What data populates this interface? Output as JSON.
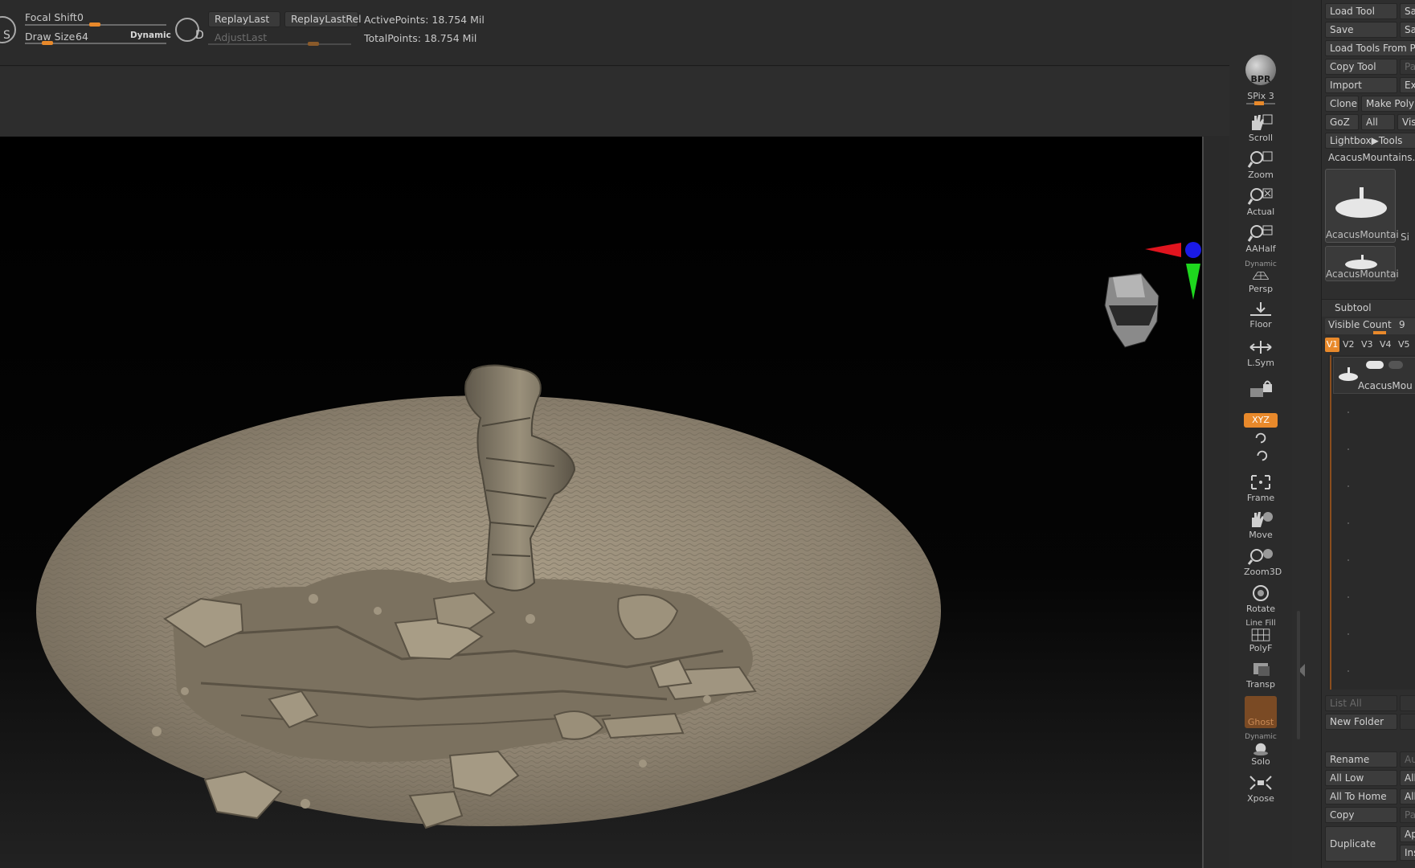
{
  "topbar": {
    "focal_shift_label": "Focal Shift",
    "focal_shift_value": "0",
    "draw_size_label": "Draw Size",
    "draw_size_value": "64",
    "dynamic_label": "Dynamic",
    "s_label": "S",
    "d_label": "D",
    "replay_last": "ReplayLast",
    "replay_last_rel": "ReplayLastRel",
    "adjust_last": "AdjustLast",
    "active_points": "ActivePoints: 18.754 Mil",
    "total_points": "TotalPoints: 18.754 Mil"
  },
  "shelf": {
    "bpr": "BPR",
    "spix_label": "SPix",
    "spix_value": "3",
    "scroll": "Scroll",
    "zoom": "Zoom",
    "actual": "Actual",
    "aahalf": "AAHalf",
    "dynamic_small": "Dynamic",
    "persp": "Persp",
    "floor": "Floor",
    "lsym": "L.Sym",
    "xyz": "XYZ",
    "frame": "Frame",
    "move": "Move",
    "zoom3d": "Zoom3D",
    "rotate": "Rotate",
    "line_fill": "Line Fill",
    "polyf": "PolyF",
    "transp": "Transp",
    "ghost": "Ghost",
    "dynamic_small2": "Dynamic",
    "solo": "Solo",
    "xpose": "Xpose"
  },
  "panel": {
    "load_tool": "Load Tool",
    "save_as": "Sa",
    "save": "Save",
    "save2": "Sa",
    "load_tools_from": "Load Tools From P",
    "copy_tool": "Copy Tool",
    "paste": "Pa",
    "import": "Import",
    "export": "Ex",
    "clone": "Clone",
    "make_poly": "Make Poly",
    "goz": "GoZ",
    "all": "All",
    "visible": "Vis",
    "lightbox_tools": "Lightbox▶Tools",
    "current_tool": "AcacusMountains.",
    "thumb1_label": "AcacusMountai",
    "thumb1_side": "Si",
    "thumb2_label": "AcacusMountai",
    "subtool_header": "Subtool",
    "visible_count_label": "Visible Count",
    "visible_count_value": "9",
    "v_tabs": [
      "V1",
      "V2",
      "V3",
      "V4",
      "V5"
    ],
    "subtool_item": "AcacusMou",
    "list_all": "List All",
    "new_folder": "New Folder",
    "rename": "Rename",
    "auto": "Au",
    "all_low": "All Low",
    "all_high": "All",
    "all_to_home": "All To Home",
    "all_to_target": "All",
    "copy": "Copy",
    "paste2": "Pa",
    "duplicate": "Duplicate",
    "append": "Ap",
    "insert": "Ins"
  },
  "colors": {
    "accent_orange": "#e8892b",
    "axis_red": "#e0141e",
    "axis_green": "#1ed61e",
    "axis_blue": "#1a1ae6",
    "mesh_base": "#8d8270"
  }
}
